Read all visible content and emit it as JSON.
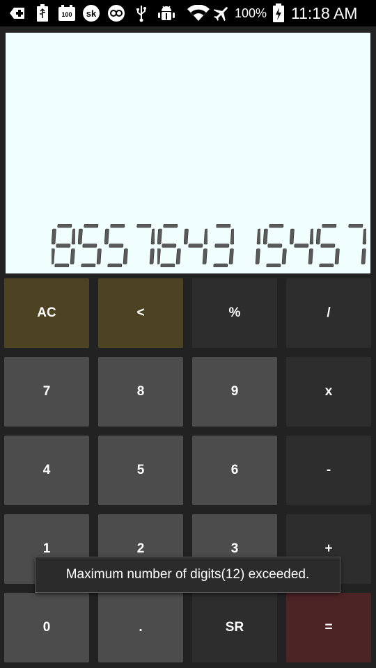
{
  "status_bar": {
    "icons": [
      "plus-icon",
      "usb-battery-icon",
      "battery-100-icon",
      "skype-icon",
      "pa-app-icon",
      "usb-icon",
      "android-debug-icon",
      "wifi-icon",
      "airplane-mode-icon"
    ],
    "battery_percent": "100%",
    "time": "11:18 AM",
    "battery_level": 1.0
  },
  "display": {
    "value": "855764315457",
    "background_color": "#f0fffe",
    "digit_color": "#5a5a5a"
  },
  "keypad": {
    "rows": [
      [
        {
          "label": "AC",
          "name": "ac-button",
          "color": "#4d4322"
        },
        {
          "label": "<",
          "name": "backspace-button",
          "color": "#4d4322"
        },
        {
          "label": "%",
          "name": "percent-button",
          "color": "#2d2d2d"
        },
        {
          "label": "/",
          "name": "divide-button",
          "color": "#2d2d2d"
        }
      ],
      [
        {
          "label": "7",
          "name": "digit-7-button",
          "color": "#4c4c4c"
        },
        {
          "label": "8",
          "name": "digit-8-button",
          "color": "#4c4c4c"
        },
        {
          "label": "9",
          "name": "digit-9-button",
          "color": "#4c4c4c"
        },
        {
          "label": "x",
          "name": "multiply-button",
          "color": "#2d2d2d"
        }
      ],
      [
        {
          "label": "4",
          "name": "digit-4-button",
          "color": "#4c4c4c"
        },
        {
          "label": "5",
          "name": "digit-5-button",
          "color": "#4c4c4c"
        },
        {
          "label": "6",
          "name": "digit-6-button",
          "color": "#4c4c4c"
        },
        {
          "label": "-",
          "name": "subtract-button",
          "color": "#2d2d2d"
        }
      ],
      [
        {
          "label": "1",
          "name": "digit-1-button",
          "color": "#4c4c4c"
        },
        {
          "label": "2",
          "name": "digit-2-button",
          "color": "#4c4c4c"
        },
        {
          "label": "3",
          "name": "digit-3-button",
          "color": "#4c4c4c"
        },
        {
          "label": "+",
          "name": "add-button",
          "color": "#2d2d2d"
        }
      ],
      [
        {
          "label": "0",
          "name": "digit-0-button",
          "color": "#4c4c4c"
        },
        {
          "label": ".",
          "name": "decimal-button",
          "color": "#4c4c4c"
        },
        {
          "label": "SR",
          "name": "square-root-button",
          "color": "#2d2d2d"
        },
        {
          "label": "=",
          "name": "equals-button",
          "color": "#4d2426"
        }
      ]
    ]
  },
  "toast": {
    "message": "Maximum number of digits(12) exceeded."
  }
}
